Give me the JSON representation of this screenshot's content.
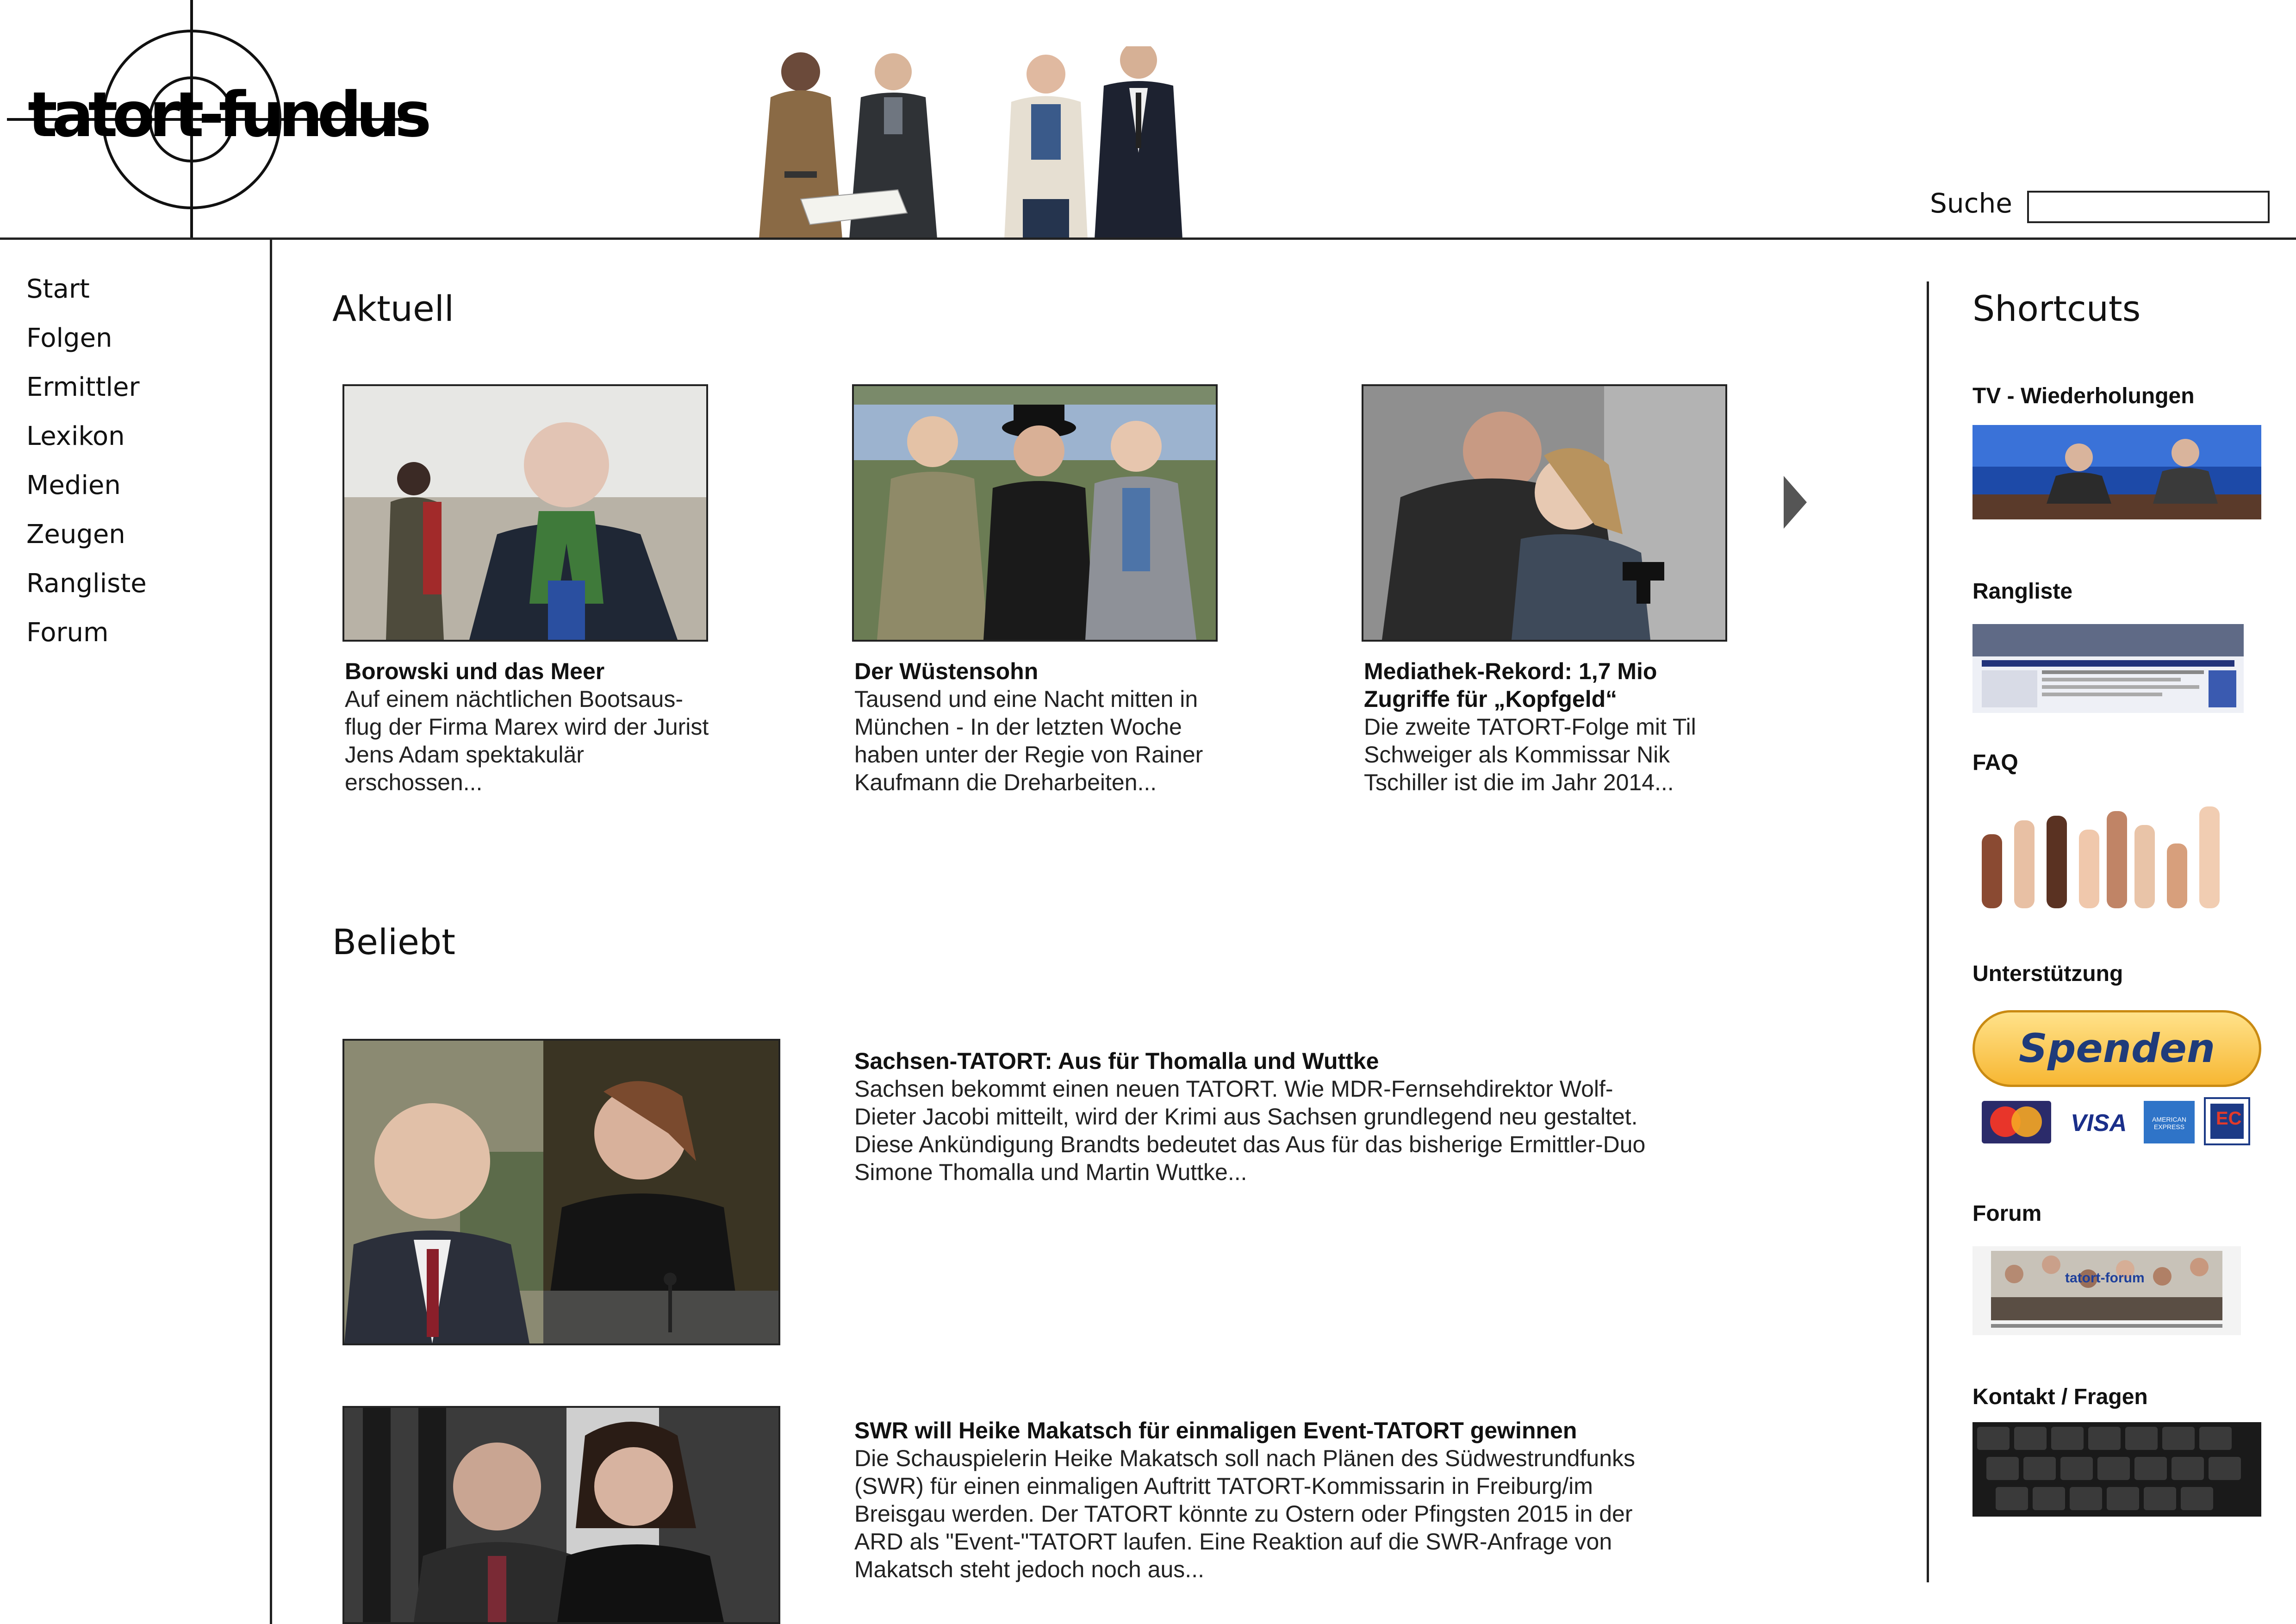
{
  "logo": {
    "text": "tatort-fundus"
  },
  "search": {
    "label": "Suche",
    "value": ""
  },
  "nav": {
    "items": [
      {
        "label": "Start"
      },
      {
        "label": "Folgen"
      },
      {
        "label": "Ermittler"
      },
      {
        "label": "Lexikon"
      },
      {
        "label": "Medien"
      },
      {
        "label": "Zeugen"
      },
      {
        "label": "Rangliste"
      },
      {
        "label": "Forum"
      }
    ]
  },
  "aktuell": {
    "title": "Aktuell",
    "next_icon": "chevron-right-icon",
    "cards": [
      {
        "title": "Borowski und das Meer",
        "text": "Auf einem nächtlichen Bootsaus-flug der Firma Marex wird der Jurist Jens Adam spektakulär erschossen..."
      },
      {
        "title": "Der Wüstensohn",
        "text": "Tausend und eine Nacht mitten in München - In der letzten Woche haben unter der Regie von Rainer Kaufmann die Dreharbeiten..."
      },
      {
        "title": "Mediathek-Rekord: 1,7 Mio Zugriffe für „Kopfgeld“",
        "text": "Die zweite TATORT-Folge mit Til Schweiger als Kommissar Nik Tschiller ist die im Jahr 2014..."
      }
    ]
  },
  "beliebt": {
    "title": "Beliebt",
    "items": [
      {
        "title": "Sachsen-TATORT: Aus für Thomalla und Wuttke",
        "text": "Sachsen bekommt einen neuen TATORT. Wie MDR-Fernsehdirektor Wolf-Dieter Jacobi mitteilt, wird der Krimi aus Sachsen grundlegend neu gestaltet. Diese Ankündigung Brandts bedeutet das Aus für das bisherige Ermittler-Duo Simone Thomalla und Martin Wuttke..."
      },
      {
        "title": "SWR will Heike Makatsch für einmaligen Event-TATORT gewinnen",
        "text": "Die Schauspielerin Heike Makatsch soll nach Plänen des Südwestrundfunks (SWR) für einen einmaligen Auftritt TATORT-Kommissarin in Freiburg/im Breisgau werden. Der TATORT könnte zu Ostern oder Pfingsten 2015 in der ARD als \"Event-\"TATORT laufen. Eine Reaktion auf die SWR-Anfrage von Makatsch steht jedoch noch aus..."
      }
    ]
  },
  "shortcuts": {
    "title": "Shortcuts",
    "items": [
      {
        "label": "TV - Wiederholungen"
      },
      {
        "label": "Rangliste"
      },
      {
        "label": "FAQ"
      },
      {
        "label": "Unterstützung",
        "donate_label": "Spenden",
        "payment_logos": [
          "MasterCard",
          "VISA",
          "AMERICAN EXPRESS",
          "EC"
        ]
      },
      {
        "label": "Forum",
        "banner_text": "tatort-forum"
      },
      {
        "label": "Kontakt / Fragen"
      }
    ]
  },
  "colors": {
    "text": "#111111",
    "border": "#222222",
    "donate_gold": "#f7b733",
    "donate_text": "#1f3b7a",
    "tv_blue": "#1d4aa8"
  }
}
